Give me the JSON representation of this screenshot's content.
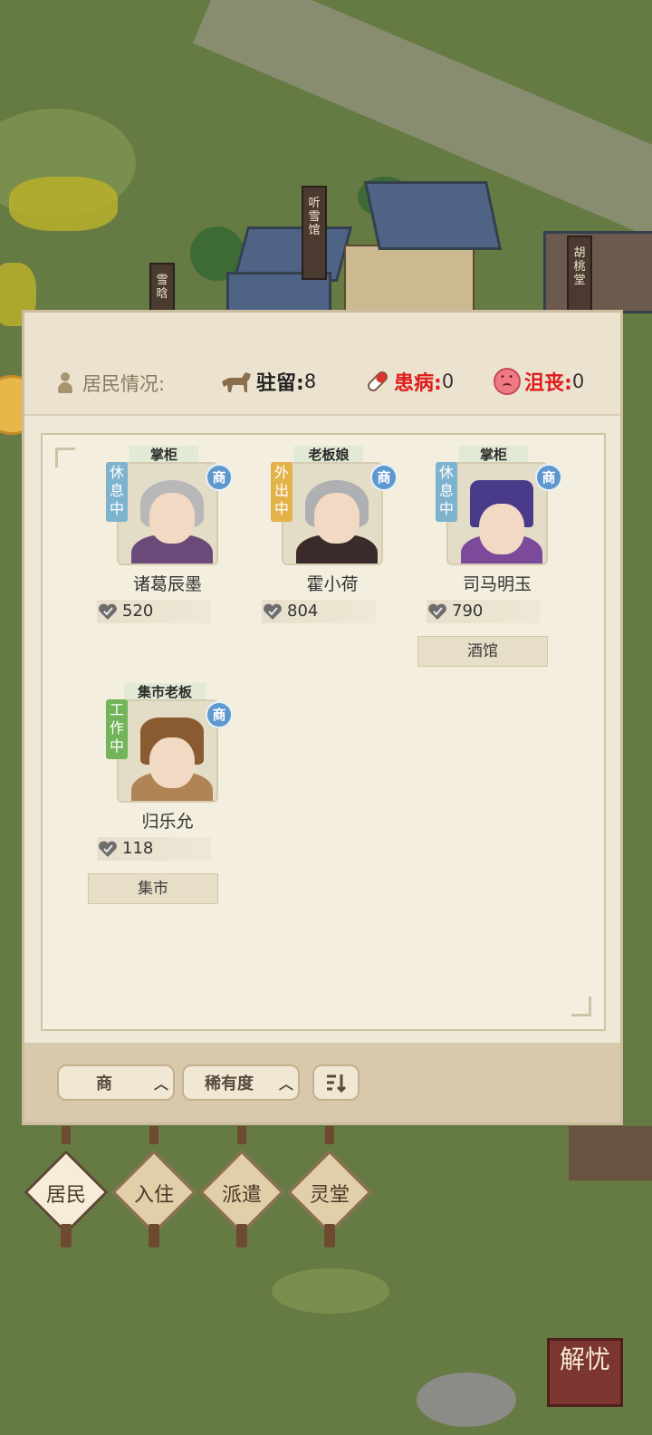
{
  "header": {
    "residents_label": "居民情况:",
    "stationed_label": "驻留:",
    "stationed_value": "8",
    "sick_label": "患病:",
    "sick_value": "0",
    "depressed_label": "沮丧:",
    "depressed_value": "0"
  },
  "map_signs": [
    "听雪馆",
    "雪晗",
    "胡桃堂"
  ],
  "residents": [
    {
      "role": "掌柜",
      "status": "休息中",
      "tag": "商",
      "name": "诸葛辰墨",
      "power": "520",
      "place": ""
    },
    {
      "role": "老板娘",
      "status": "外出中",
      "tag": "商",
      "name": "霍小荷",
      "power": "804",
      "place": ""
    },
    {
      "role": "掌柜",
      "status": "休息中",
      "tag": "商",
      "name": "司马明玉",
      "power": "790",
      "place": "酒馆"
    },
    {
      "role": "集市老板",
      "status": "工作中",
      "tag": "商",
      "name": "归乐允",
      "power": "118",
      "place": "集市"
    }
  ],
  "filters": {
    "type": "商",
    "sort": "稀有度",
    "order_icon": "sort-order-icon"
  },
  "tabs": [
    "居民",
    "入住",
    "派遣",
    "灵堂"
  ],
  "corner_button": "解忧",
  "colors": {
    "sick_red": "#e01b1b",
    "status_rest": "#7eb3cf",
    "status_out": "#e3b24a",
    "status_work": "#73b35a",
    "tag_blue": "#5e98cf"
  }
}
